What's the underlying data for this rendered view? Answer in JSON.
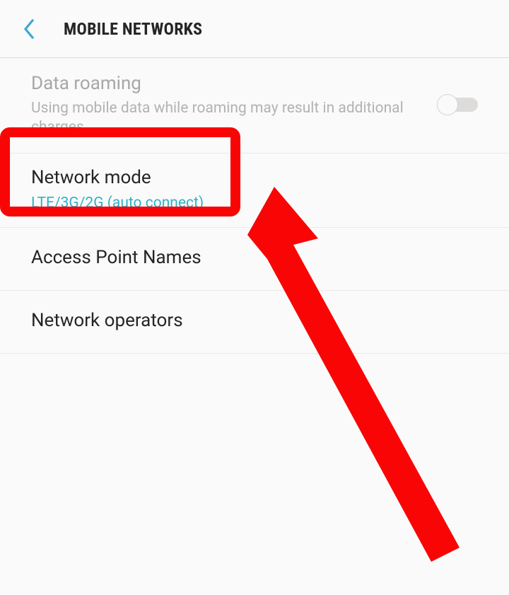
{
  "header": {
    "title": "MOBILE NETWORKS"
  },
  "items": {
    "roaming": {
      "title": "Data roaming",
      "sub": "Using mobile data while roaming may result in additional charges."
    },
    "network_mode": {
      "title": "Network mode",
      "sub": "LTE/3G/2G (auto connect)"
    },
    "apn": {
      "title": "Access Point Names"
    },
    "operators": {
      "title": "Network operators"
    }
  }
}
